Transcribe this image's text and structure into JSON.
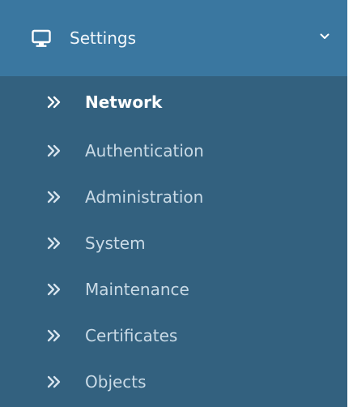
{
  "header": {
    "title": "Settings",
    "icon": "monitor-icon",
    "toggle_icon": "chevron-down-icon",
    "bg_color": "#3a77a0"
  },
  "submenu": {
    "bg_color": "#33617f",
    "active_color": "#ffffff",
    "inactive_color": "#c9dae6",
    "item_icon": "double-chevron-right-icon",
    "items": [
      {
        "label": "Network",
        "active": true
      },
      {
        "label": "Authentication",
        "active": false
      },
      {
        "label": "Administration",
        "active": false
      },
      {
        "label": "System",
        "active": false
      },
      {
        "label": "Maintenance",
        "active": false
      },
      {
        "label": "Certificates",
        "active": false
      },
      {
        "label": "Objects",
        "active": false
      }
    ]
  }
}
